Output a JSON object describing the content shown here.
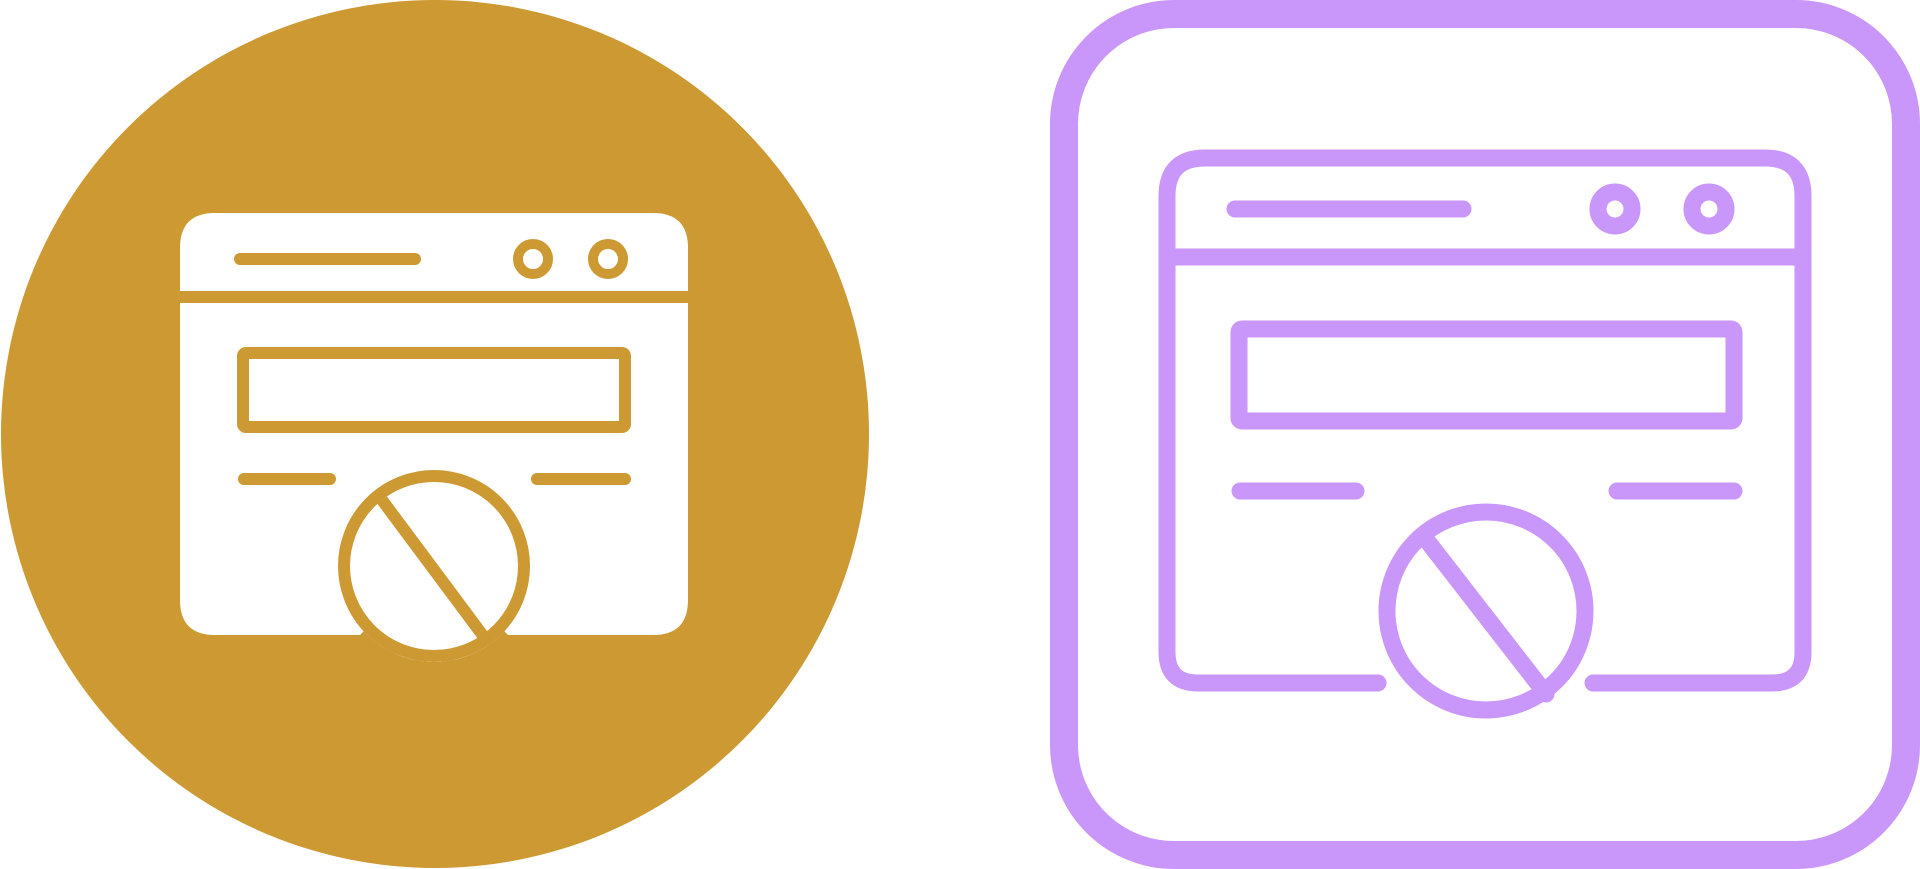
{
  "icons": [
    {
      "id": "glyph",
      "style": "glyph",
      "depicts": "blocked-browser-window-icon",
      "colors": {
        "background": "#CC9933",
        "foreground": "#FFFFFF"
      }
    },
    {
      "id": "line",
      "style": "line",
      "depicts": "blocked-browser-window-icon",
      "colors": {
        "stroke": "#C996FA",
        "background": "#FFFFFF"
      }
    }
  ]
}
